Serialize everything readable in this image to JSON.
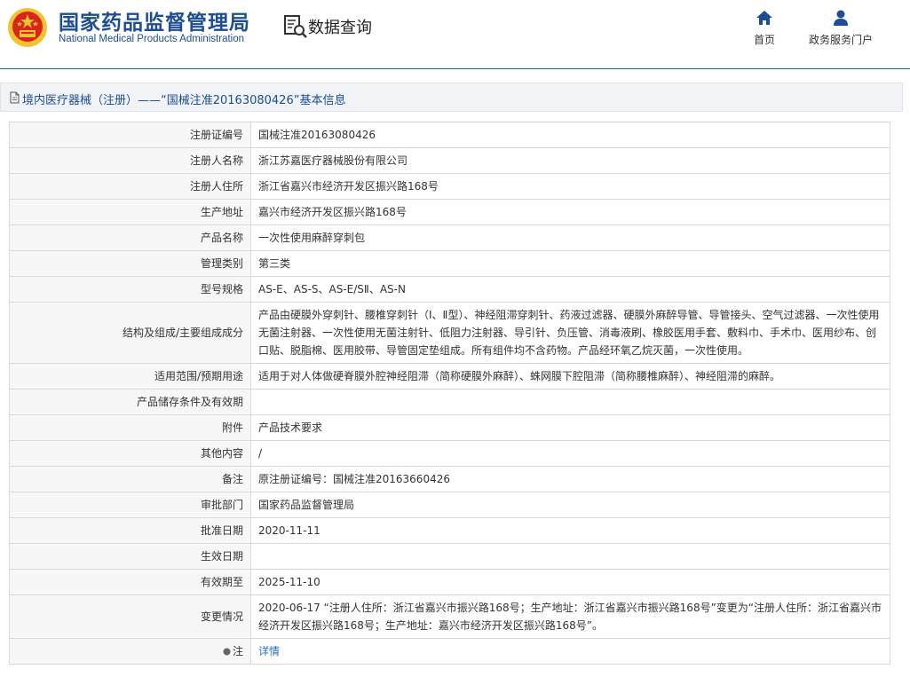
{
  "header": {
    "org_name_cn": "国家药品监督管理局",
    "org_name_en": "National Medical Products Administration",
    "page_title": "数据查询",
    "nav": [
      {
        "label": "首页",
        "icon": "home-icon"
      },
      {
        "label": "政务服务门户",
        "icon": "user-icon"
      }
    ]
  },
  "section": {
    "title": "境内医疗器械（注册）——“国械注准20163080426”基本信息"
  },
  "table": {
    "rows": [
      {
        "label": "注册证编号",
        "value": "国械注准20163080426"
      },
      {
        "label": "注册人名称",
        "value": "浙江苏嘉医疗器械股份有限公司"
      },
      {
        "label": "注册人住所",
        "value": "浙江省嘉兴市经济开发区振兴路168号"
      },
      {
        "label": "生产地址",
        "value": "嘉兴市经济开发区振兴路168号"
      },
      {
        "label": "产品名称",
        "value": "一次性使用麻醉穿刺包"
      },
      {
        "label": "管理类别",
        "value": "第三类"
      },
      {
        "label": "型号规格",
        "value": "AS-E、AS-S、AS-E/SⅡ、AS-N"
      },
      {
        "label": "结构及组成/主要组成成分",
        "value": "产品由硬膜外穿刺针、腰椎穿刺针（Ⅰ、Ⅱ型）、神经阻滞穿刺针、药液过滤器、硬膜外麻醉导管、导管接头、空气过滤器、一次性使用无菌注射器、一次性使用无菌注射针、低阻力注射器、导引针、负压管、消毒液刷、橡胶医用手套、敷料巾、手术巾、医用纱布、创口贴、脱脂棉、医用胶带、导管固定垫组成。所有组件均不含药物。产品经环氧乙烷灭菌，一次性使用。"
      },
      {
        "label": "适用范围/预期用途",
        "value": "适用于对人体做硬脊膜外腔神经阻滞（简称硬膜外麻醉）、蛛网膜下腔阻滞（简称腰椎麻醉）、神经阻滞的麻醉。"
      },
      {
        "label": "产品储存条件及有效期",
        "value": ""
      },
      {
        "label": "附件",
        "value": "产品技术要求"
      },
      {
        "label": "其他内容",
        "value": "/"
      },
      {
        "label": "备注",
        "value": "原注册证编号：国械注准20163660426"
      },
      {
        "label": "审批部门",
        "value": "国家药品监督管理局"
      },
      {
        "label": "批准日期",
        "value": "2020-11-11"
      },
      {
        "label": "生效日期",
        "value": ""
      },
      {
        "label": "有效期至",
        "value": "2025-11-10"
      },
      {
        "label": "变更情况",
        "value": "2020-06-17 “注册人住所：浙江省嘉兴市振兴路168号；生产地址：浙江省嘉兴市振兴路168号”变更为“注册人住所：浙江省嘉兴市经济开发区振兴路168号；生产地址：嘉兴市经济开发区振兴路168号”。"
      }
    ],
    "note_label": "注",
    "note_link": "详情"
  },
  "colors": {
    "brand_blue": "#1c4d95",
    "link_blue": "#2a6ebf",
    "emblem_red": "#d9261c",
    "emblem_gold": "#f2c230"
  }
}
